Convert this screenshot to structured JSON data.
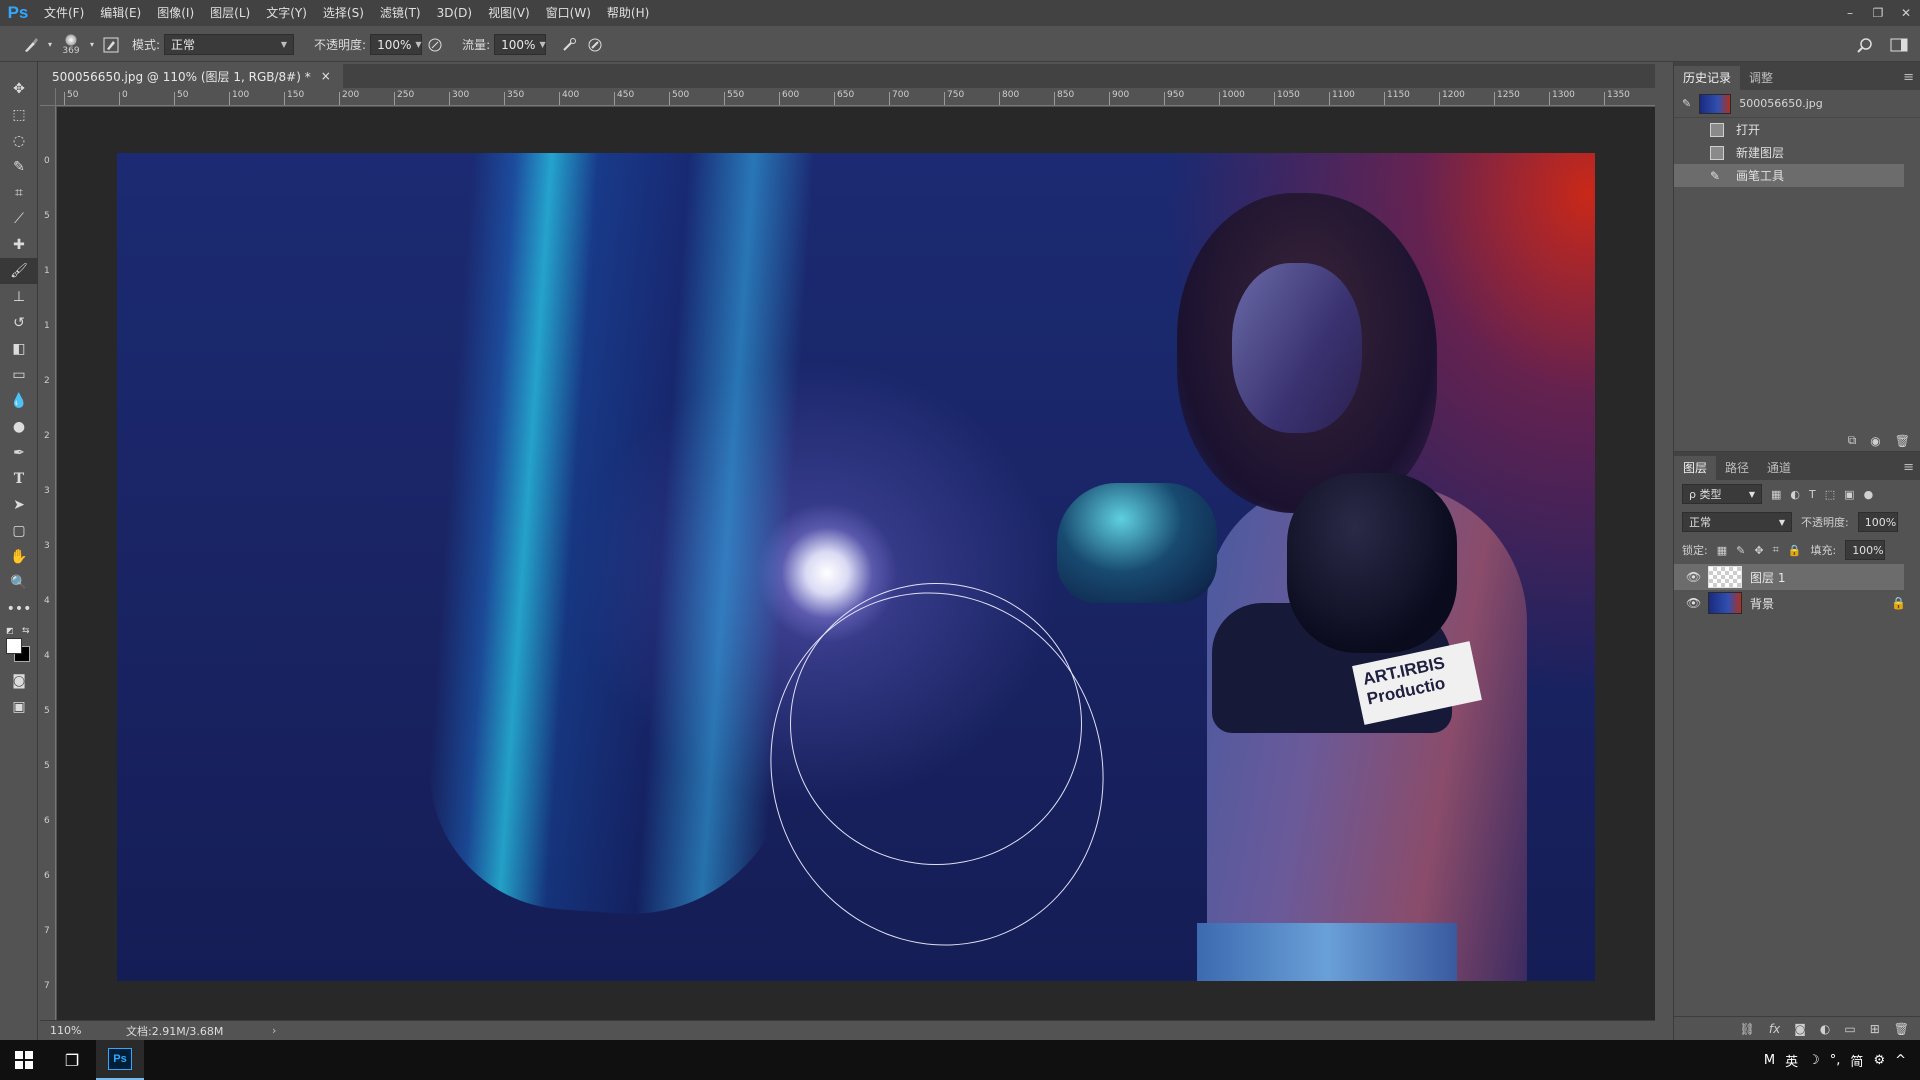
{
  "app": {
    "logo": "Ps"
  },
  "menu": [
    "文件(F)",
    "编辑(E)",
    "图像(I)",
    "图层(L)",
    "文字(Y)",
    "选择(S)",
    "滤镜(T)",
    "3D(D)",
    "视图(V)",
    "窗口(W)",
    "帮助(H)"
  ],
  "options": {
    "brush_size": "369",
    "mode_label": "模式:",
    "mode_value": "正常",
    "opacity_label": "不透明度:",
    "opacity_value": "100%",
    "flow_label": "流量:",
    "flow_value": "100%"
  },
  "document": {
    "tab_title": "500056650.jpg @ 110% (图层 1, RGB/8#) *",
    "close": "×",
    "canvas_text": "ART.IRBIS Productio"
  },
  "rulers": {
    "h": [
      "50",
      "0",
      "50",
      "100",
      "150",
      "200",
      "250",
      "300",
      "350",
      "400",
      "450",
      "500",
      "550",
      "600",
      "650",
      "700",
      "750",
      "800",
      "850",
      "900",
      "950",
      "1000",
      "1050",
      "1100",
      "1150",
      "1200",
      "1250",
      "1300",
      "1350"
    ],
    "v": [
      "0",
      "5",
      "1",
      "1",
      "2",
      "2",
      "3",
      "3",
      "4",
      "4",
      "5",
      "5",
      "6",
      "6",
      "7",
      "7"
    ]
  },
  "status": {
    "zoom": "110%",
    "doc_info": "文档:2.91M/3.68M",
    "arrow": "›"
  },
  "history": {
    "tabs": [
      "历史记录",
      "调整"
    ],
    "snapshot": "500056650.jpg",
    "items": [
      "打开",
      "新建图层",
      "画笔工具"
    ]
  },
  "layers": {
    "tabs": [
      "图层",
      "路径",
      "通道"
    ],
    "filter": "ρ 类型",
    "blend": "正常",
    "opacity_label": "不透明度:",
    "opacity_value": "100%",
    "lock_label": "锁定:",
    "fill_label": "填充:",
    "fill_value": "100%",
    "items": [
      {
        "name": "图层 1"
      },
      {
        "name": "背景"
      }
    ]
  },
  "taskbar": {
    "tray": [
      "M",
      "英",
      "☽",
      "°,",
      "简",
      "⚙",
      "^"
    ]
  }
}
